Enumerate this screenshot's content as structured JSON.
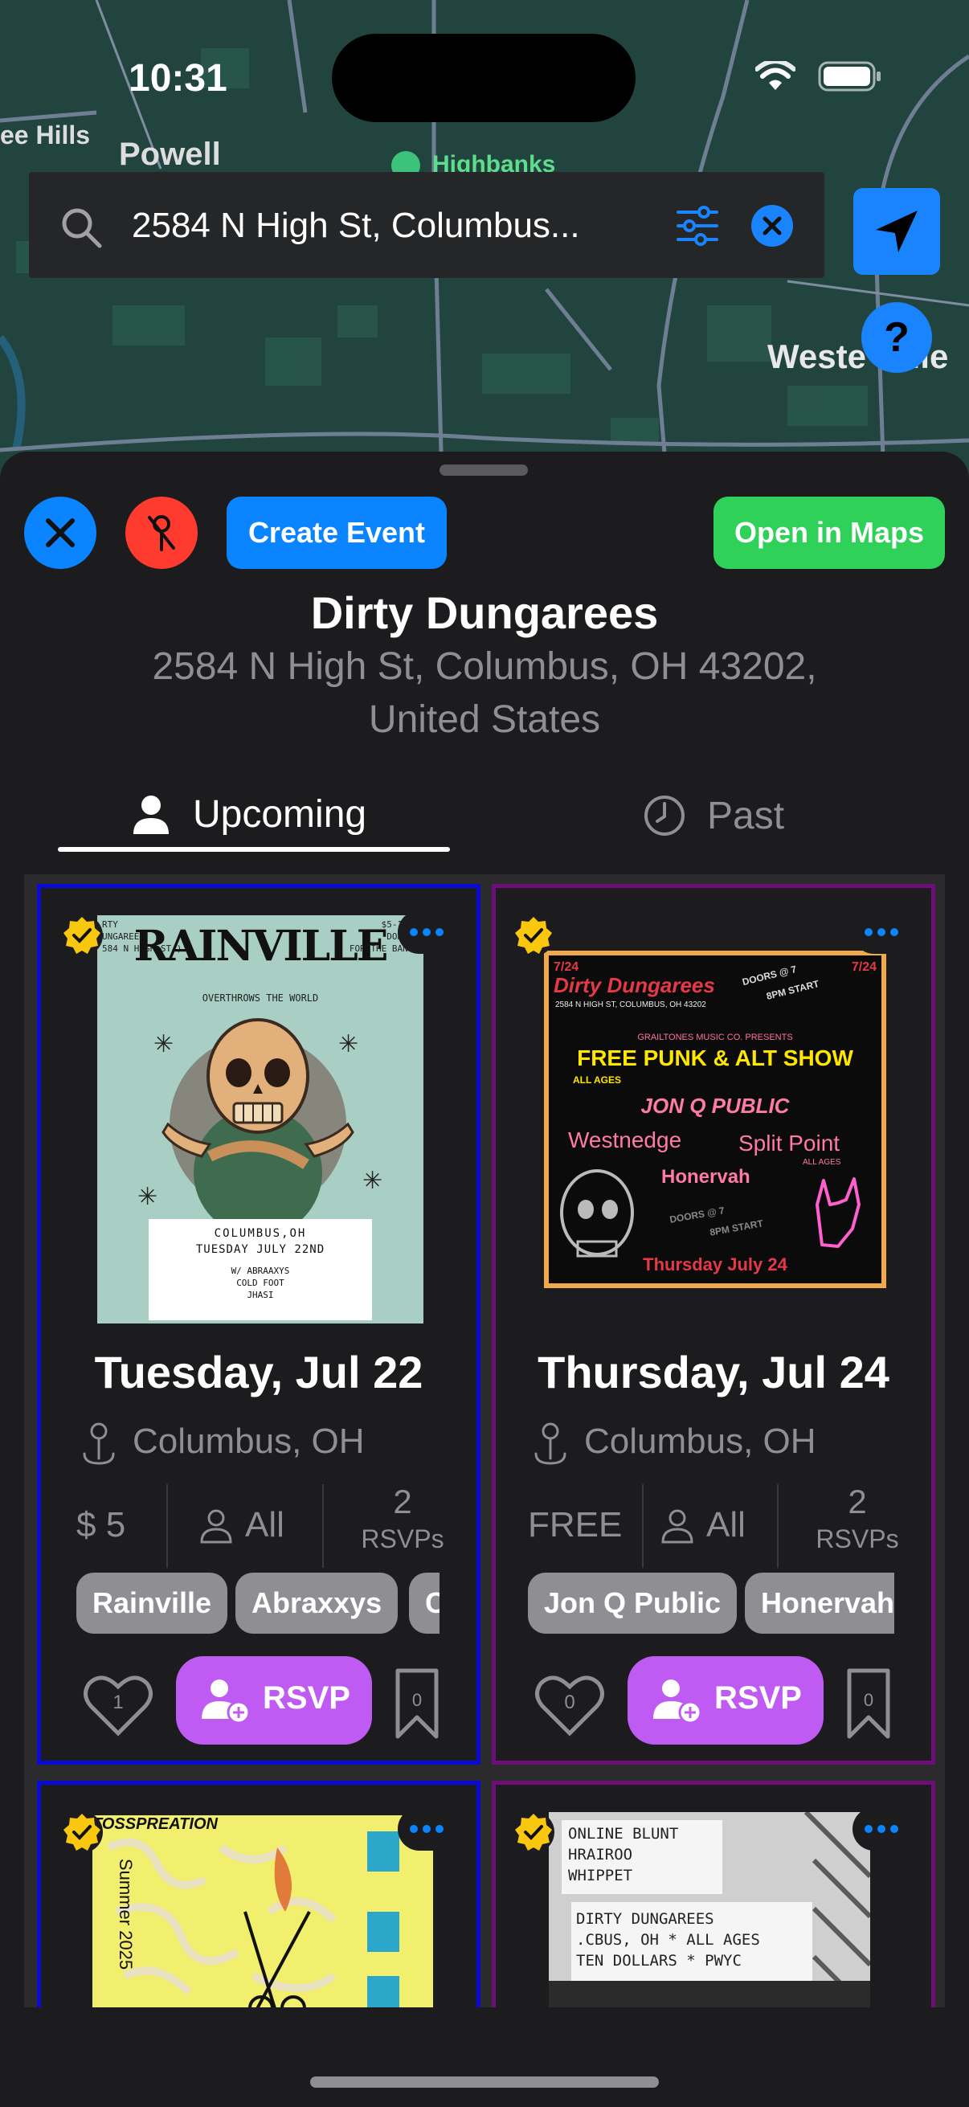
{
  "status_bar": {
    "time": "10:31"
  },
  "map": {
    "labels": [
      "ee Hills",
      "Powell",
      "Highbanks",
      "Weste",
      "ille"
    ],
    "colors": {
      "land": "#22443f",
      "water": "#1e3a4a",
      "road": "#6e7f93"
    }
  },
  "search": {
    "value": "2584 N High St, Columbus...",
    "icons": [
      "search-icon",
      "filter-icon",
      "clear-icon"
    ]
  },
  "map_controls": {
    "locate_icon": "location-arrow-icon",
    "help_label": "?"
  },
  "sheet": {
    "buttons": {
      "close_icon": "close-icon",
      "pin_off_icon": "pin-off-icon",
      "create_event": "Create Event",
      "open_in_maps": "Open in Maps"
    },
    "colors": {
      "blue": "#0a84ff",
      "red": "#ff3b30",
      "green": "#30d158",
      "purple": "#bf5af2"
    }
  },
  "venue": {
    "name": "Dirty Dungarees",
    "address_line1": "2584 N High St, Columbus, OH  43202,",
    "address_line2": "United States"
  },
  "tabs": {
    "upcoming": "Upcoming",
    "past": "Past"
  },
  "events": [
    {
      "date": "Tuesday, Jul 22",
      "location": "Columbus, OH",
      "price": "$ 5",
      "ages": "All",
      "rsvp_count": "2",
      "rsvp_label": "RSVPs",
      "artists": [
        "Rainville",
        "Abraxxys",
        "Co"
      ],
      "likes": "1",
      "saves": "0",
      "rsvp_button": "RSVP",
      "border_color": "#0a0ad6",
      "poster": {
        "title": "RAINVILLE",
        "subtitle": "OVERTHROWS THE WORLD",
        "left_corner": [
          "RTY",
          "UNGAREES",
          "584 N HIGH ST.)"
        ],
        "right_corner": [
          "$5-10 P",
          "DONATI",
          "FOR THE BANDS"
        ],
        "box": [
          "COLUMBUS,OH",
          "TUESDAY JULY 22ND",
          "W/ ABRAAXYS",
          "COLD FOOT",
          "JHASI"
        ]
      }
    },
    {
      "date": "Thursday, Jul 24",
      "location": "Columbus, OH",
      "price": "FREE",
      "ages": "All",
      "rsvp_count": "2",
      "rsvp_label": "RSVPs",
      "artists": [
        "Jon Q Public",
        "Honervah"
      ],
      "likes": "0",
      "saves": "0",
      "rsvp_button": "RSVP",
      "border_color": "#6e0f75",
      "poster": {
        "date_tag": "7/24",
        "venue": "Dirty Dungarees",
        "address": "2584 N HIGH ST, COLUMBUS, OH 43202",
        "doors": "DOORS @ 7",
        "start": "8PM START",
        "presents": "GRAILTONES MUSIC CO. PRESENTS",
        "headline": "FREE PUNK & ALT SHOW",
        "all_ages": "ALL AGES",
        "band1": "JON Q PUBLIC",
        "band2": "Westnedge",
        "band3": "Split Point",
        "band3_note": "ALL AGES",
        "band4": "Honervah",
        "footer": "Thursday July 24"
      }
    },
    {
      "border_color": "#0a0ad6",
      "poster": {
        "title": "TOSSPREATION",
        "vertical": "Summer 2025"
      }
    },
    {
      "border_color": "#6e0f75",
      "poster": {
        "line1": "ONLINE BLUNT",
        "line2": "HRAIROO",
        "line3": "WHIPPET",
        "line4": "DIRTY DUNGAREES",
        "line5": ".CBUS, OH * ALL AGES",
        "line6": "TEN DOLLARS * PWYC"
      }
    }
  ]
}
